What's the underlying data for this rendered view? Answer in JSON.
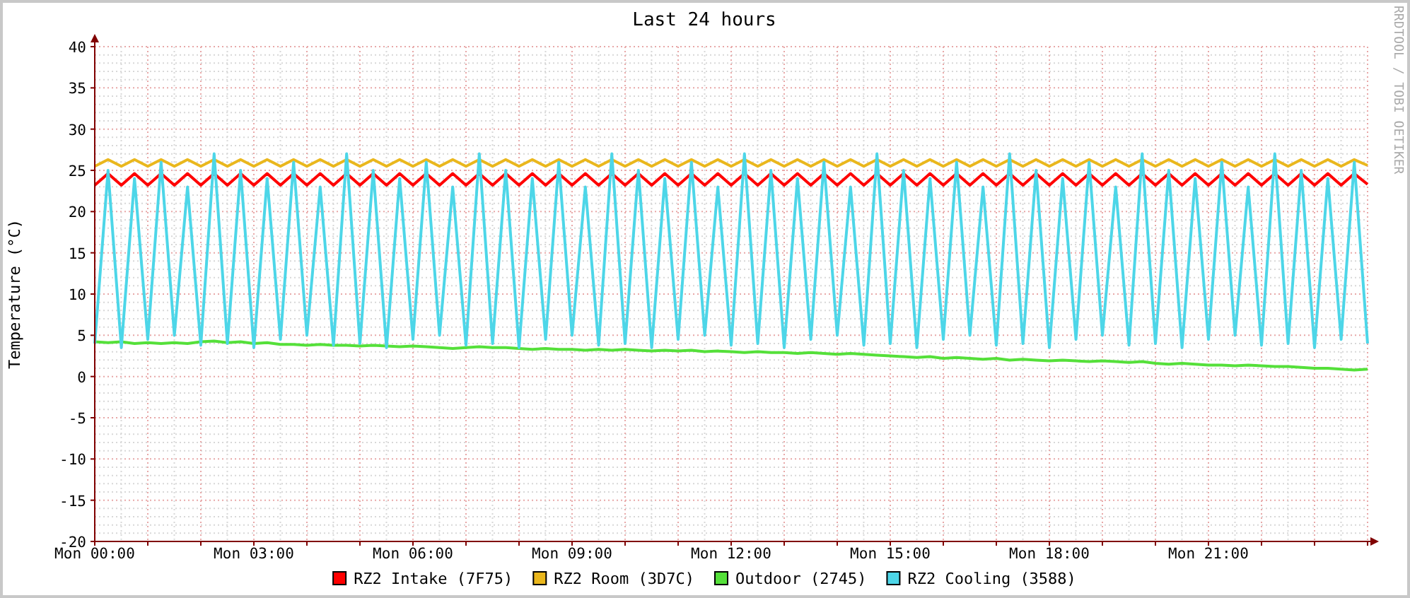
{
  "chart": {
    "chart_data": {
      "type": "line",
      "title": "Last 24 hours",
      "ylabel": "Temperature (°C)",
      "grid": true,
      "legend": "bottom",
      "ylim": [
        -20,
        40
      ],
      "yticks": [
        -20,
        -15,
        -10,
        -5,
        0,
        5,
        10,
        15,
        20,
        25,
        30,
        35,
        40
      ],
      "categories": [
        "Mon 00:00",
        null,
        null,
        null,
        null,
        null,
        null,
        null,
        null,
        null,
        null,
        null,
        "Mon 03:00",
        null,
        null,
        null,
        null,
        null,
        null,
        null,
        null,
        null,
        null,
        null,
        "Mon 06:00",
        null,
        null,
        null,
        null,
        null,
        null,
        null,
        null,
        null,
        null,
        null,
        "Mon 09:00",
        null,
        null,
        null,
        null,
        null,
        null,
        null,
        null,
        null,
        null,
        null,
        "Mon 12:00",
        null,
        null,
        null,
        null,
        null,
        null,
        null,
        null,
        null,
        null,
        null,
        "Mon 15:00",
        null,
        null,
        null,
        null,
        null,
        null,
        null,
        null,
        null,
        null,
        null,
        "Mon 18:00",
        null,
        null,
        null,
        null,
        null,
        null,
        null,
        null,
        null,
        null,
        null,
        "Mon 21:00",
        null,
        null,
        null,
        null,
        null,
        null,
        null,
        null,
        null,
        null,
        null,
        null
      ],
      "series": [
        {
          "name": "RZ2 Intake (7F75)",
          "color": "#ff0000",
          "values": [
            23.2,
            24.6,
            23.2,
            24.6,
            23.2,
            24.6,
            23.2,
            24.6,
            23.2,
            24.6,
            23.2,
            24.6,
            23.2,
            24.6,
            23.2,
            24.6,
            23.2,
            24.6,
            23.2,
            24.6,
            23.2,
            24.6,
            23.2,
            24.6,
            23.2,
            24.6,
            23.2,
            24.6,
            23.2,
            24.6,
            23.2,
            24.6,
            23.2,
            24.6,
            23.2,
            24.6,
            23.2,
            24.6,
            23.2,
            24.6,
            23.2,
            24.6,
            23.2,
            24.6,
            23.2,
            24.6,
            23.2,
            24.6,
            23.2,
            24.6,
            23.2,
            24.6,
            23.2,
            24.6,
            23.2,
            24.6,
            23.2,
            24.6,
            23.2,
            24.6,
            23.2,
            24.6,
            23.2,
            24.6,
            23.2,
            24.6,
            23.2,
            24.6,
            23.2,
            24.6,
            23.2,
            24.6,
            23.2,
            24.6,
            23.2,
            24.6,
            23.2,
            24.6,
            23.2,
            24.6,
            23.2,
            24.6,
            23.2,
            24.6,
            23.2,
            24.6,
            23.2,
            24.6,
            23.2,
            24.6,
            23.2,
            24.6,
            23.2,
            24.6,
            23.2,
            24.6,
            23.3
          ]
        },
        {
          "name": "RZ2 Room (3D7C)",
          "color": "#eab71d",
          "values": [
            25.5,
            26.3,
            25.5,
            26.3,
            25.5,
            26.3,
            25.5,
            26.3,
            25.5,
            26.3,
            25.5,
            26.3,
            25.5,
            26.3,
            25.5,
            26.3,
            25.5,
            26.3,
            25.5,
            26.3,
            25.5,
            26.3,
            25.5,
            26.3,
            25.5,
            26.3,
            25.5,
            26.3,
            25.5,
            26.3,
            25.5,
            26.3,
            25.5,
            26.3,
            25.5,
            26.3,
            25.5,
            26.3,
            25.5,
            26.3,
            25.5,
            26.3,
            25.5,
            26.3,
            25.5,
            26.3,
            25.5,
            26.3,
            25.5,
            26.3,
            25.5,
            26.3,
            25.5,
            26.3,
            25.5,
            26.3,
            25.5,
            26.3,
            25.5,
            26.3,
            25.5,
            26.3,
            25.5,
            26.3,
            25.5,
            26.3,
            25.5,
            26.3,
            25.5,
            26.3,
            25.5,
            26.3,
            25.5,
            26.3,
            25.5,
            26.3,
            25.5,
            26.3,
            25.5,
            26.3,
            25.5,
            26.3,
            25.5,
            26.3,
            25.5,
            26.3,
            25.5,
            26.3,
            25.5,
            26.3,
            25.5,
            26.3,
            25.5,
            26.3,
            25.5,
            26.3,
            25.6
          ]
        },
        {
          "name": "Outdoor (2745)",
          "color": "#55e03a",
          "values": [
            4.2,
            4.1,
            4.2,
            4.0,
            4.1,
            4.0,
            4.1,
            4.0,
            4.2,
            4.3,
            4.1,
            4.2,
            4.0,
            4.1,
            3.9,
            3.9,
            3.8,
            3.9,
            3.8,
            3.8,
            3.7,
            3.8,
            3.7,
            3.6,
            3.7,
            3.6,
            3.5,
            3.4,
            3.5,
            3.6,
            3.5,
            3.5,
            3.4,
            3.3,
            3.4,
            3.3,
            3.3,
            3.2,
            3.3,
            3.2,
            3.3,
            3.2,
            3.1,
            3.2,
            3.1,
            3.2,
            3.0,
            3.1,
            3.0,
            2.9,
            3.0,
            2.9,
            2.9,
            2.8,
            2.9,
            2.8,
            2.7,
            2.8,
            2.7,
            2.6,
            2.5,
            2.4,
            2.3,
            2.4,
            2.2,
            2.3,
            2.2,
            2.1,
            2.2,
            2.0,
            2.1,
            2.0,
            1.9,
            2.0,
            1.9,
            1.8,
            1.9,
            1.8,
            1.7,
            1.8,
            1.6,
            1.5,
            1.6,
            1.5,
            1.4,
            1.4,
            1.3,
            1.4,
            1.3,
            1.2,
            1.2,
            1.1,
            1.0,
            1.0,
            0.9,
            0.8,
            0.9
          ]
        },
        {
          "name": "RZ2 Cooling (3588)",
          "color": "#4dd6e8",
          "values": [
            4,
            25,
            3.5,
            24,
            4.5,
            26,
            5,
            23,
            3.8,
            27,
            4,
            25,
            3.5,
            24,
            4.5,
            26,
            5,
            23,
            3.8,
            27,
            4,
            25,
            3.5,
            24,
            4.5,
            26,
            5,
            23,
            3.8,
            27,
            4,
            25,
            3.5,
            24,
            4.5,
            26,
            5,
            23,
            3.8,
            27,
            4,
            25,
            3.5,
            24,
            4.5,
            26,
            5,
            23,
            3.8,
            27,
            4,
            25,
            3.5,
            24,
            4.5,
            26,
            5,
            23,
            3.8,
            27,
            4,
            25,
            3.5,
            24,
            4.5,
            26,
            5,
            23,
            3.8,
            27,
            4,
            25,
            3.5,
            24,
            4.5,
            26,
            5,
            23,
            3.8,
            27,
            4,
            25,
            3.5,
            24,
            4.5,
            26,
            5,
            23,
            3.8,
            27,
            4,
            25,
            3.5,
            24,
            4.5,
            26,
            4
          ]
        }
      ]
    }
  },
  "credit": "RRDTOOL / TOBI OETIKER"
}
